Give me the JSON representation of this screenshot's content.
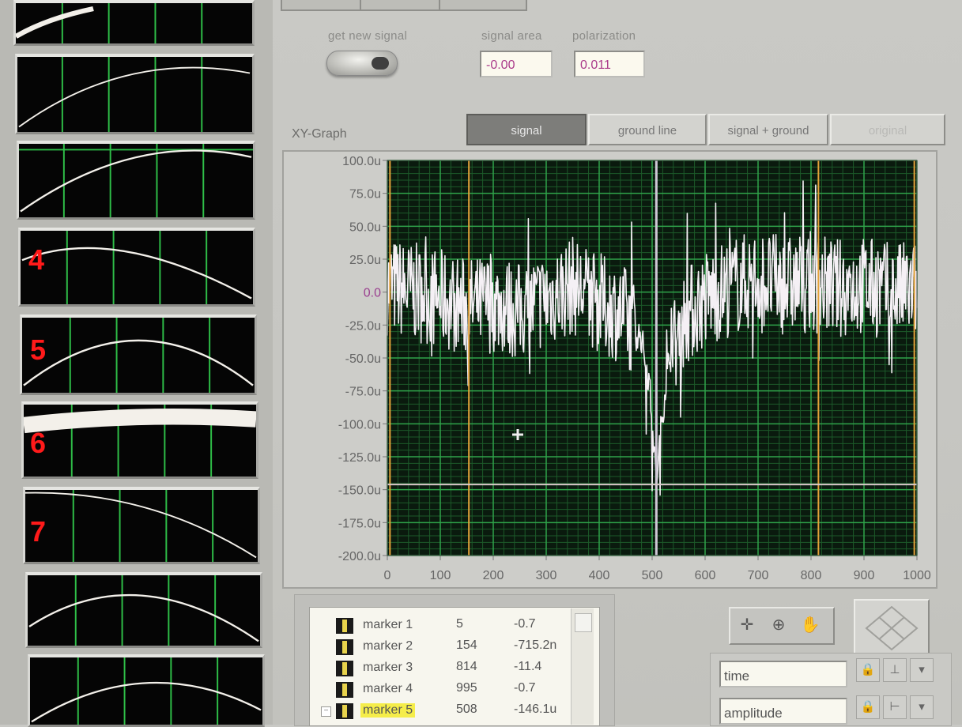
{
  "controls": {
    "get_new_signal_label": "get new signal",
    "signal_area_label": "signal area",
    "signal_area_value": "-0.00",
    "polarization_label": "polarization",
    "polarization_value": "0.011"
  },
  "graph": {
    "title": "XY-Graph",
    "tabs": [
      {
        "label": "signal",
        "selected": true
      },
      {
        "label": "ground line",
        "selected": false
      },
      {
        "label": "signal + ground",
        "selected": false
      },
      {
        "label": "original",
        "selected": false
      }
    ]
  },
  "thumbnails": {
    "numbers": [
      "4",
      "5",
      "6",
      "7"
    ]
  },
  "chart_data": {
    "type": "line",
    "title": "",
    "xlabel": "",
    "ylabel": "",
    "xlim": [
      0,
      1000
    ],
    "ylim": [
      -200,
      100
    ],
    "x_ticks": [
      "0",
      "100",
      "200",
      "300",
      "400",
      "500",
      "600",
      "700",
      "800",
      "900",
      "1000"
    ],
    "y_ticks": [
      "100.0u",
      "75.0u",
      "50.0u",
      "25.0u",
      "0.0",
      "-25.0u",
      "-50.0u",
      "-75.0u",
      "-100.0u",
      "-125.0u",
      "-150.0u",
      "-175.0u",
      "-200.0u"
    ],
    "grid": true,
    "series": [
      {
        "x": [
          0,
          50,
          100,
          150,
          200,
          250,
          300,
          350,
          400,
          450,
          480,
          495,
          502,
          508,
          515,
          530,
          560,
          600,
          650,
          700,
          750,
          800,
          850,
          900,
          950,
          1000
        ],
        "y": [
          5,
          0,
          -5,
          -12,
          -8,
          -15,
          -5,
          5,
          -8,
          -18,
          -35,
          -70,
          -110,
          -146,
          -110,
          -55,
          -20,
          -5,
          5,
          10,
          5,
          8,
          3,
          5,
          0,
          2
        ]
      }
    ],
    "markers": [
      {
        "name": "marker 1",
        "x": "5",
        "y": "-0.7"
      },
      {
        "name": "marker 2",
        "x": "154",
        "y": "-715.2n"
      },
      {
        "name": "marker 3",
        "x": "814",
        "y": "-11.4"
      },
      {
        "name": "marker 4",
        "x": "995",
        "y": "-0.7"
      },
      {
        "name": "marker 5",
        "x": "508",
        "y": "-146.1u"
      }
    ]
  },
  "axis_panel": {
    "x_name": "time",
    "y_name": "amplitude"
  },
  "colors": {
    "plot_background": "#0a1a0e",
    "grid": "#2fa34a",
    "trace": "#f5f0f5",
    "marker_line": "#e3a23a",
    "marker_highlight": "#f5ed4a"
  }
}
